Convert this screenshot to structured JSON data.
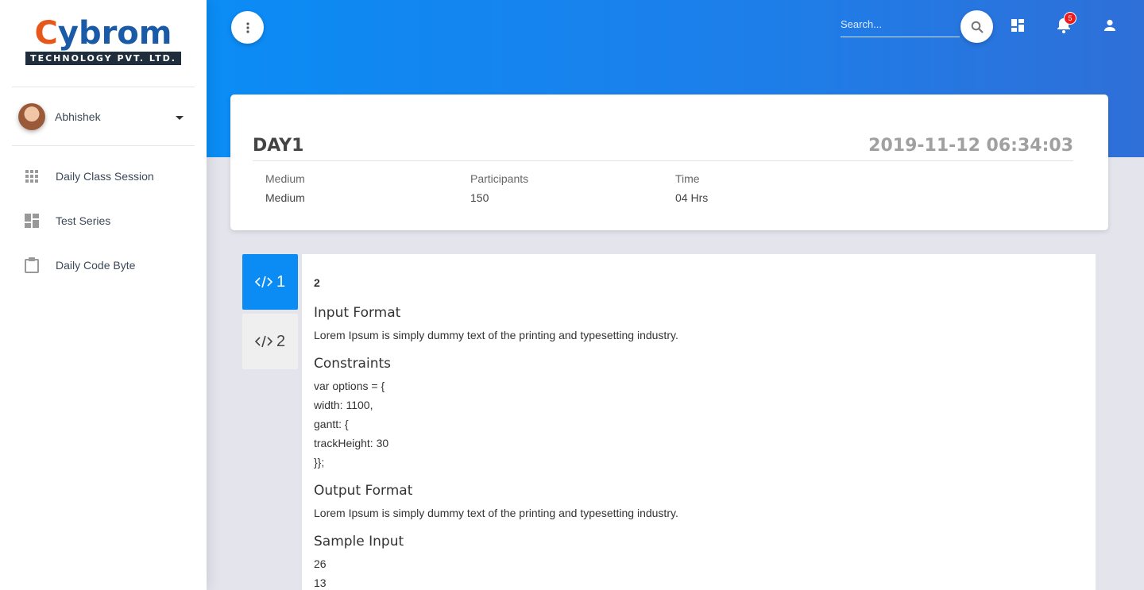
{
  "brand": {
    "logo_first_letter": "C",
    "logo_rest": "ybrom",
    "logo_tagline": "TECHNOLOGY PVT. LTD."
  },
  "user": {
    "name": "Abhishek"
  },
  "sidebar": {
    "items": [
      {
        "label": "Daily Class Session",
        "icon": "apps-grid-icon"
      },
      {
        "label": "Test Series",
        "icon": "dashboard-icon"
      },
      {
        "label": "Daily Code Byte",
        "icon": "clipboard-icon"
      }
    ]
  },
  "header": {
    "search_placeholder": "Search...",
    "notification_count": "5",
    "icons": [
      "more-vertical-icon",
      "search-icon",
      "dashboard-icon",
      "bell-icon",
      "person-icon"
    ]
  },
  "session": {
    "title": "DAY1",
    "datetime": "2019-11-12 06:34:03",
    "medium_label": "Medium",
    "medium_value": "Medium",
    "participants_label": "Participants",
    "participants_value": "150",
    "time_label": "Time",
    "time_value": "04 Hrs"
  },
  "tabs": [
    {
      "label": "1",
      "icon": "code-icon",
      "active": true
    },
    {
      "label": "2",
      "icon": "code-icon",
      "active": false
    }
  ],
  "problem": {
    "number": "2",
    "input_format_heading": "Input Format",
    "input_format_text": "Lorem Ipsum is simply dummy text of the printing and typesetting industry.",
    "constraints_heading": "Constraints",
    "constraints_lines": [
      "var options = {",
      "width: 1100,",
      "gantt: {",
      "trackHeight: 30",
      "}};"
    ],
    "output_format_heading": "Output Format",
    "output_format_text": "Lorem Ipsum is simply dummy text of the printing and typesetting industry.",
    "sample_input_heading": "Sample Input",
    "sample_input_lines": [
      "26",
      "13"
    ]
  },
  "colors": {
    "accent": "#0b8cf5",
    "header_gradient_end": "#2f6fd8",
    "badge": "#f01c1c",
    "logo_orange": "#e8571a",
    "logo_blue": "#1b5aa6"
  }
}
